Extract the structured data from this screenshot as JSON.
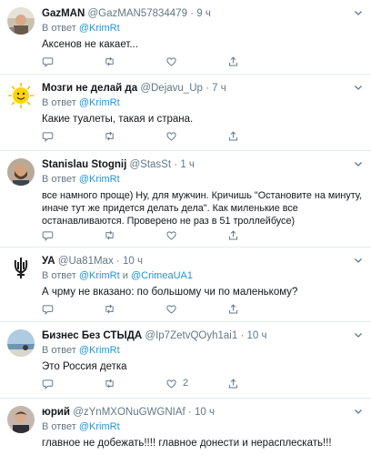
{
  "replying_prefix": "В ответ",
  "tweets": [
    {
      "name": "GazMAN",
      "handle": "@GazMAN57834479",
      "time": "9 ч",
      "mentions": [
        "@KrimRt"
      ],
      "text": "Аксенов не какает...",
      "counts": {
        "reply": "",
        "retweet": "",
        "like": ""
      },
      "avatar": "person-in-car-avatar"
    },
    {
      "name": "Мозги не делай да",
      "handle": "@Dejavu_Up",
      "time": "7 ч",
      "mentions": [
        "@KrimRt"
      ],
      "text": "Какие туалеты, такая и страна.",
      "counts": {
        "reply": "",
        "retweet": "",
        "like": ""
      },
      "avatar": "yellow-smiley-avatar"
    },
    {
      "name": "Stanislau Stognij",
      "handle": "@StasSt",
      "time": "1 ч",
      "mentions": [
        "@KrimRt"
      ],
      "text": "все намного проще) Ну, для мужчин. Кричишь \"Остановите на минуту, иначе тут же придется делать дела\". Как миленькие все останавливаются. Проверено не раз в 51 троллейбусе)",
      "counts": {
        "reply": "",
        "retweet": "",
        "like": ""
      },
      "avatar": "bearded-man-avatar"
    },
    {
      "name": "УА",
      "handle": "@Ua81Max",
      "time": "10 ч",
      "mentions": [
        "@KrimRt",
        "@CrimeaUA1"
      ],
      "conjunction": "и",
      "text": "А чрму не вказано: по большому чи по маленькому?",
      "counts": {
        "reply": "",
        "retweet": "",
        "like": ""
      },
      "avatar": "trident-emblem-avatar"
    },
    {
      "name": "Бизнес Без СТЫДА",
      "handle": "@Ip7ZetvQOyh1ai1",
      "time": "10 ч",
      "mentions": [
        "@KrimRt"
      ],
      "text": "Это Россия детка",
      "counts": {
        "reply": "",
        "retweet": "",
        "like": "2"
      },
      "avatar": "seascape-avatar"
    },
    {
      "name": "юрий",
      "handle": "@zYnMXONuGWGNIAf",
      "time": "10 ч",
      "mentions": [
        "@KrimRt"
      ],
      "text": "главное  не добежать!!!!  главное  донести и нерасплескать!!!",
      "counts": {
        "reply": "",
        "retweet": "",
        "like": ""
      },
      "avatar": "man-portrait-avatar"
    }
  ],
  "colors": {
    "link": "#1b95e0",
    "secondary_text": "#657786",
    "primary_text": "#14171a",
    "divider": "#e6ecf0"
  }
}
